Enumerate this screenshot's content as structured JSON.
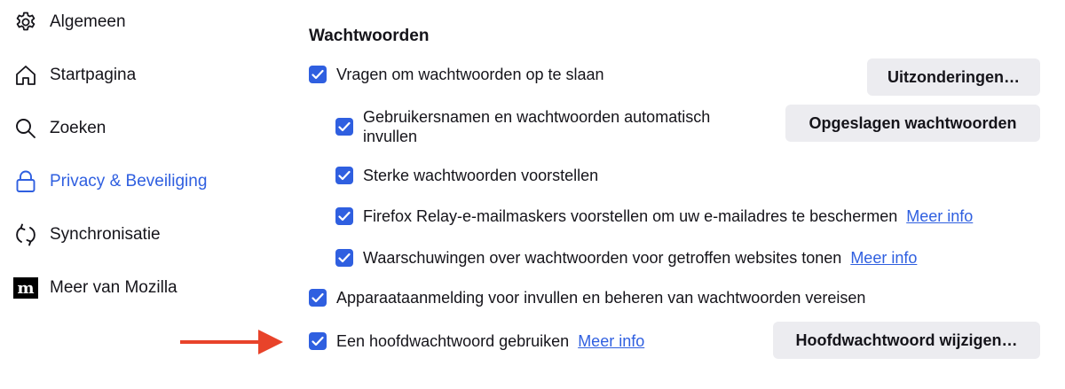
{
  "sidebar": {
    "items": [
      {
        "label": "Algemeen",
        "icon": "gear-icon"
      },
      {
        "label": "Startpagina",
        "icon": "home-icon"
      },
      {
        "label": "Zoeken",
        "icon": "search-icon"
      },
      {
        "label": "Privacy & Beveiliging",
        "icon": "lock-icon"
      },
      {
        "label": "Synchronisatie",
        "icon": "sync-icon"
      },
      {
        "label": "Meer van Mozilla",
        "icon": "mozilla-icon"
      }
    ]
  },
  "main": {
    "section_title": "Wachtwoorden",
    "options": [
      {
        "label": "Vragen om wachtwoorden op te slaan",
        "checked": true
      },
      {
        "label": "Gebruikersnamen en wachtwoorden automatisch invullen",
        "checked": true
      },
      {
        "label": "Sterke wachtwoorden voorstellen",
        "checked": true
      },
      {
        "label": "Firefox Relay-e-mailmaskers voorstellen om uw e-mailadres te beschermen",
        "checked": true,
        "link": "Meer info"
      },
      {
        "label": "Waarschuwingen over wachtwoorden voor getroffen websites tonen",
        "checked": true,
        "link": "Meer info"
      },
      {
        "label": "Apparaataanmelding voor invullen en beheren van wachtwoorden vereisen",
        "checked": true
      },
      {
        "label": "Een hoofdwachtwoord gebruiken",
        "checked": true,
        "link": "Meer info"
      }
    ],
    "buttons": {
      "exceptions": "Uitzonderingen…",
      "saved_passwords": "Opgeslagen wachtwoorden",
      "change_primary_password": "Hoofdwachtwoord wijzigen…"
    }
  },
  "colors": {
    "accent": "#2f5fe0",
    "arrow": "#e8432a",
    "button_bg": "#ececf0"
  }
}
